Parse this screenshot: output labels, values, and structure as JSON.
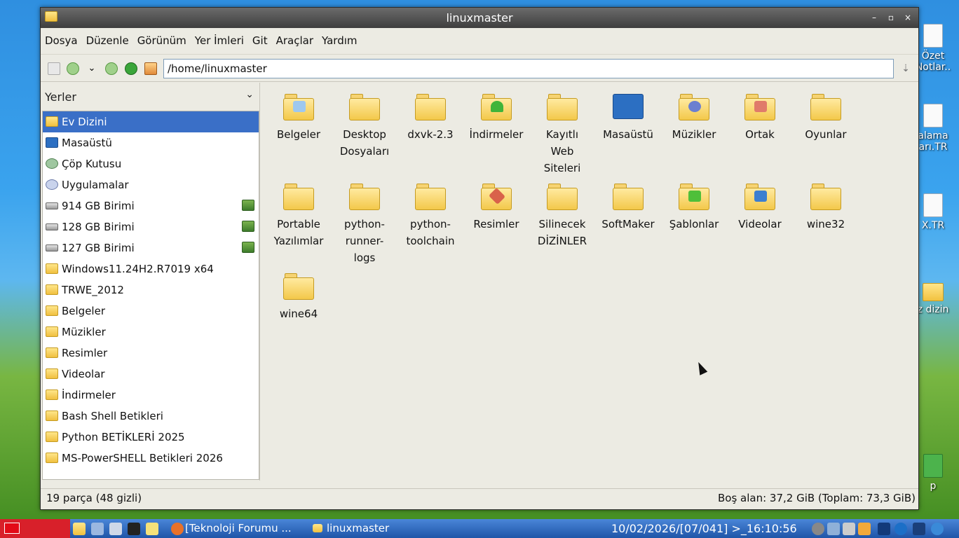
{
  "desktop": {
    "icons": [
      {
        "label": "Özet Notlar..",
        "kind": "doc"
      },
      {
        "label": "alama arı.TR",
        "kind": "doc"
      },
      {
        "label": "X.TR",
        "kind": "doc"
      },
      {
        "label": "z dizin",
        "kind": "folder"
      },
      {
        "label": "p",
        "kind": "trash"
      }
    ]
  },
  "window": {
    "title": "linuxmaster",
    "controls": {
      "minimize": "–",
      "maximize": "▫",
      "close": "×"
    }
  },
  "menubar": [
    "Dosya",
    "Düzenle",
    "Görünüm",
    "Yer İmleri",
    "Git",
    "Araçlar",
    "Yardım"
  ],
  "toolbar": {
    "buttons": [
      "new-tab-icon",
      "back-icon",
      "history-dropdown-icon",
      "forward-icon",
      "up-icon",
      "home-icon"
    ],
    "location": "/home/linuxmaster"
  },
  "sidepane": {
    "header": "Yerler",
    "items": [
      {
        "label": "Ev Dizini",
        "icon": "home-folder-icon",
        "selected": true
      },
      {
        "label": "Masaüstü",
        "icon": "desktop-icon"
      },
      {
        "label": "Çöp Kutusu",
        "icon": "trash-icon"
      },
      {
        "label": "Uygulamalar",
        "icon": "applications-icon"
      },
      {
        "label": "914 GB Birimi",
        "icon": "drive-icon",
        "eject": true
      },
      {
        "label": "128 GB Birimi",
        "icon": "drive-icon",
        "eject": true
      },
      {
        "label": "127 GB Birimi",
        "icon": "drive-icon",
        "eject": true
      },
      {
        "label": "Windows11.24H2.R7019 x64",
        "icon": "folder-icon"
      },
      {
        "label": "TRWE_2012",
        "icon": "folder-icon"
      },
      {
        "label": "Belgeler",
        "icon": "documents-folder-icon"
      },
      {
        "label": "Müzikler",
        "icon": "music-folder-icon"
      },
      {
        "label": "Resimler",
        "icon": "pictures-folder-icon"
      },
      {
        "label": "Videolar",
        "icon": "videos-folder-icon"
      },
      {
        "label": "İndirmeler",
        "icon": "downloads-folder-icon"
      },
      {
        "label": "Bash Shell Betikleri",
        "icon": "folder-icon"
      },
      {
        "label": "Python BETİKLERİ 2025",
        "icon": "folder-icon"
      },
      {
        "label": "MS-PowerSHELL Betikleri 2026",
        "icon": "folder-icon"
      }
    ]
  },
  "content": {
    "items": [
      {
        "label": "Belgeler",
        "icon": "documents-folder-icon",
        "emblem": "#9ec8ef"
      },
      {
        "label": "Desktop Dosyaları",
        "icon": "folder-icon"
      },
      {
        "label": "dxvk-2.3",
        "icon": "folder-icon"
      },
      {
        "label": "İndirmeler",
        "icon": "downloads-folder-icon",
        "emblem": "#3fb43a"
      },
      {
        "label": "Kayıtlı Web Siteleri",
        "icon": "folder-icon"
      },
      {
        "label": "Masaüstü",
        "icon": "desktop-icon",
        "emblem": "#2c6fc2"
      },
      {
        "label": "Müzikler",
        "icon": "music-folder-icon",
        "emblem": "#6b7fd0"
      },
      {
        "label": "Ortak",
        "icon": "shared-folder-icon",
        "emblem": "#e07b6a"
      },
      {
        "label": "Oyunlar",
        "icon": "folder-icon"
      },
      {
        "label": "Portable Yazılımlar",
        "icon": "folder-icon"
      },
      {
        "label": "python-runner-logs",
        "icon": "folder-icon"
      },
      {
        "label": "python-toolchain",
        "icon": "folder-icon"
      },
      {
        "label": "Resimler",
        "icon": "pictures-folder-icon",
        "emblem": "#d9624a"
      },
      {
        "label": "Silinecek DİZİNLER",
        "icon": "folder-icon"
      },
      {
        "label": "SoftMaker",
        "icon": "folder-icon"
      },
      {
        "label": "Şablonlar",
        "icon": "templates-folder-icon",
        "emblem": "#4fbf3a"
      },
      {
        "label": "Videolar",
        "icon": "videos-folder-icon",
        "emblem": "#3c7fd0"
      },
      {
        "label": "wine32",
        "icon": "folder-icon"
      },
      {
        "label": "wine64",
        "icon": "folder-icon"
      }
    ]
  },
  "statusbar": {
    "left": "19 parça (48 gizli)",
    "right": "Boş alan: 37,2 GiB (Toplam: 73,3 GiB)"
  },
  "taskbar": {
    "tasks": [
      {
        "label": "[Teknoloji Forumu ...",
        "icon": "firefox-icon"
      },
      {
        "label": "linuxmaster",
        "icon": "folder-icon"
      }
    ],
    "clock": "10/02/2026/[07/041] >_16:10:56"
  },
  "colors": {
    "selection": "#3a6fc7",
    "titlebar": "#4a4a4a",
    "window_bg": "#ecebe3",
    "taskbar": "#2a66bd"
  }
}
